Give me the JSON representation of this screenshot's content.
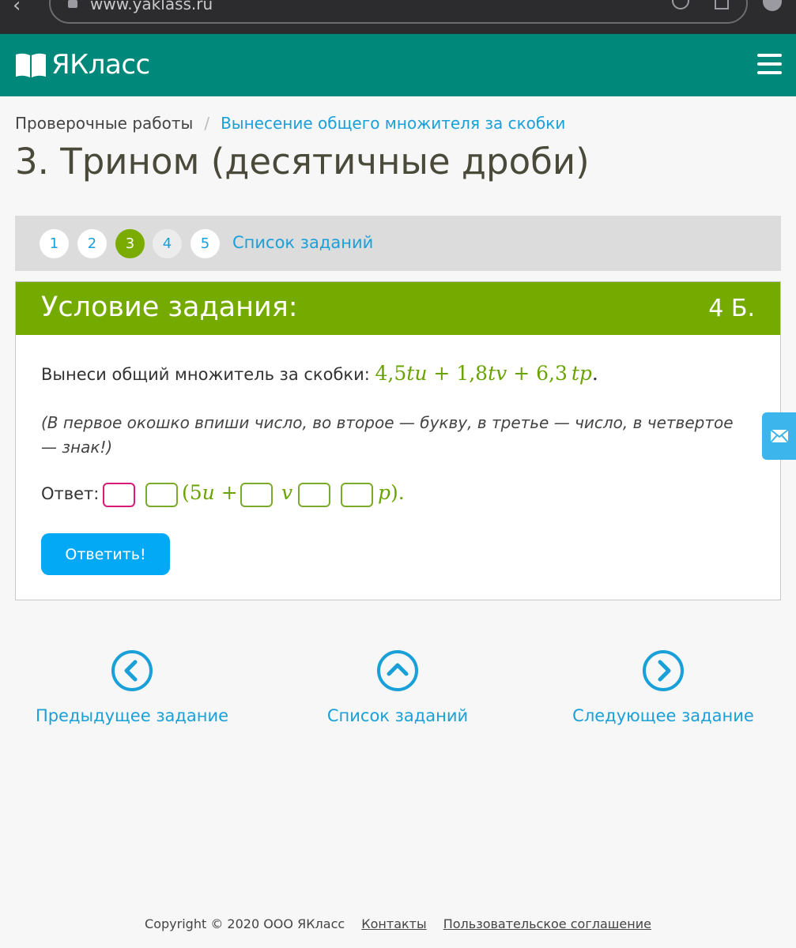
{
  "browser": {
    "url": "www.yaklass.ru"
  },
  "header": {
    "logo_text": "ЯКласс"
  },
  "breadcrumb": {
    "root": "Проверочные работы",
    "separator": "/",
    "current": "Вынесение общего множителя за скобки"
  },
  "page_title": "3. Трином (десятичные дроби)",
  "task_nav": {
    "numbers": [
      "1",
      "2",
      "3",
      "4",
      "5"
    ],
    "active_index": 2,
    "list_label": "Список заданий"
  },
  "task": {
    "header_title": "Условие задания:",
    "points": "4 Б.",
    "text_prefix": "Вынеси общий множитель за скобки:",
    "expression": {
      "c1": "4,5",
      "v1": "tu",
      "op1": "+",
      "c2": "1,8",
      "v2": "tv",
      "op2": "+",
      "c3": "6,3",
      "v3": "tp",
      "end": "."
    },
    "hint": "(В первое окошко впиши число, во второе — букву, в третье — число, в четвертое — знак!)",
    "answer_label": "Ответ:",
    "answer_parts": {
      "open": "(5",
      "u": "u",
      "plus": "+",
      "v": "v",
      "p": "p",
      "close": ")."
    },
    "submit_label": "Ответить!"
  },
  "bottom_nav": {
    "prev": "Предыдущее задание",
    "list": "Список заданий",
    "next": "Следующее задание"
  },
  "footer": {
    "copyright": "Copyright © 2020 ООО ЯКласс",
    "contacts": "Контакты",
    "agreement": "Пользовательское соглашение"
  },
  "colors": {
    "header_teal": "#00897b",
    "task_green": "#75ab00",
    "link_blue": "#1aa0d8",
    "button_blue": "#03a9f4",
    "focus_pink": "#d81b77"
  }
}
